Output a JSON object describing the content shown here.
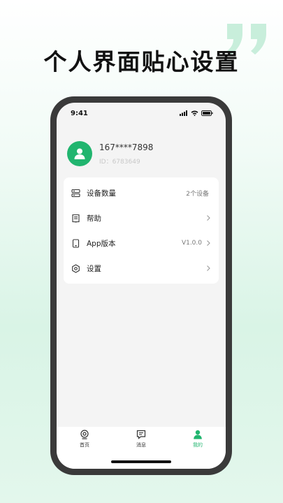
{
  "headline": "个人界面贴心设置",
  "status_bar": {
    "time": "9:41"
  },
  "profile": {
    "phone": "167****7898",
    "user_id": "ID：6783649"
  },
  "menu": [
    {
      "icon": "device-list-icon",
      "label": "设备数量",
      "value": "2个设备"
    },
    {
      "icon": "help-book-icon",
      "label": "帮助",
      "value": ""
    },
    {
      "icon": "phone-version-icon",
      "label": "App版本",
      "value": "V1.0.0"
    },
    {
      "icon": "settings-hexagon-icon",
      "label": "设置",
      "value": ""
    }
  ],
  "tabs": [
    {
      "icon": "camera-icon",
      "label": "首页",
      "active": false
    },
    {
      "icon": "message-icon",
      "label": "消息",
      "active": false
    },
    {
      "icon": "person-icon",
      "label": "我的",
      "active": true
    }
  ],
  "colors": {
    "accent": "#21b56f",
    "phone_frame": "#3a3a3a"
  }
}
